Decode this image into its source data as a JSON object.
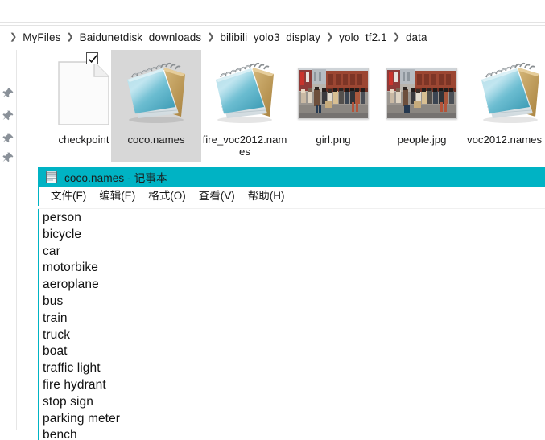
{
  "explorer": {
    "breadcrumb": {
      "name": "address-bar",
      "items": [
        "MyFiles",
        "Baidunetdisk_downloads",
        "bilibili_yolo3_display",
        "yolo_tf2.1",
        "data"
      ],
      "separator": "❯"
    },
    "quick_access_pins": [
      {
        "icon": "pin-icon",
        "label": ""
      },
      {
        "icon": "pin-icon",
        "label": ""
      },
      {
        "icon": "pin-icon",
        "label": ""
      },
      {
        "icon": "pin-icon",
        "label": ""
      }
    ],
    "files": [
      {
        "name": "checkpoint",
        "icon": "blank-document-icon",
        "selected": false
      },
      {
        "name": "coco.names",
        "icon": "notepad-file-icon",
        "selected": true
      },
      {
        "name": "fire_voc2012.names",
        "icon": "notepad-file-icon",
        "selected": false
      },
      {
        "name": "girl.png",
        "icon": "image-thumbnail",
        "selected": false
      },
      {
        "name": "people.jpg",
        "icon": "image-thumbnail",
        "selected": false
      },
      {
        "name": "voc2012.names",
        "icon": "notepad-file-icon",
        "selected": false
      }
    ],
    "selected_checkbox_state": "checked"
  },
  "notepad": {
    "title": "coco.names - 记事本",
    "title_icon": "notepad-icon",
    "titlebar_color": "#00b3c4",
    "menu": [
      "文件(F)",
      "编辑(E)",
      "格式(O)",
      "查看(V)",
      "帮助(H)"
    ],
    "content_lines": [
      "person",
      "bicycle",
      "car",
      "motorbike",
      "aeroplane",
      "bus",
      "train",
      "truck",
      "boat",
      "traffic light",
      "fire hydrant",
      "stop sign",
      "parking meter",
      "bench"
    ]
  }
}
